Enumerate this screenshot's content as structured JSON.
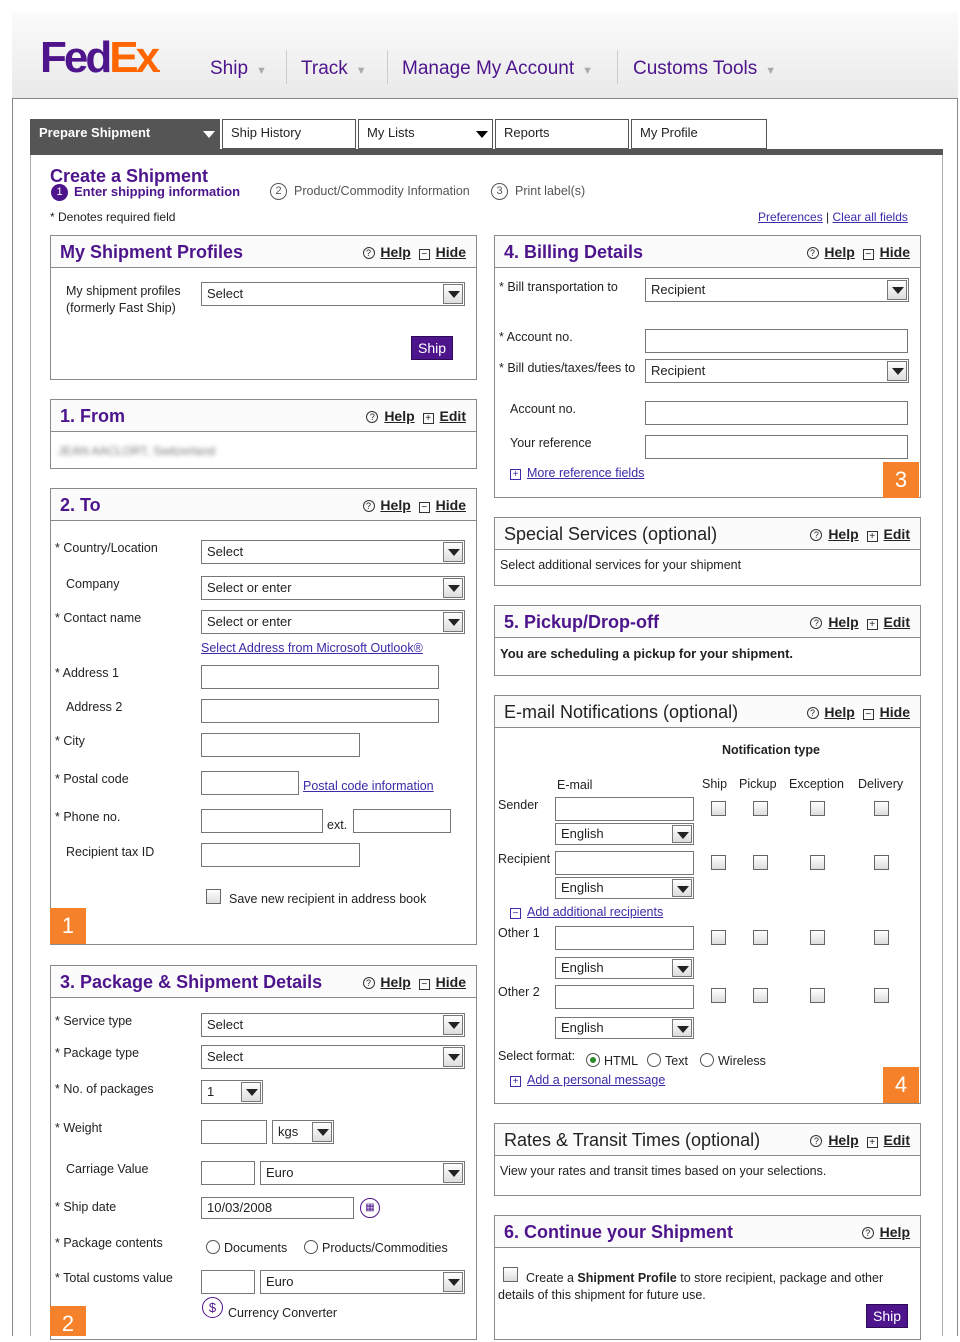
{
  "nav": {
    "logo_fed": "Fed",
    "logo_ex": "Ex",
    "items": [
      "Ship",
      "Track",
      "Manage My Account",
      "Customs Tools"
    ]
  },
  "tabs": [
    "Prepare Shipment",
    "Ship History",
    "My Lists",
    "Reports",
    "My Profile"
  ],
  "header": {
    "title": "Create a Shipment",
    "step1": "Enter shipping information",
    "step2": "Product/Commodity Information",
    "step3": "Print label(s)",
    "required_note": "* Denotes required field",
    "preferences": "Preferences",
    "clear": "Clear all fields",
    "sep": "|"
  },
  "common": {
    "help": "Help",
    "hide": "Hide",
    "edit": "Edit"
  },
  "profiles": {
    "title": "My Shipment Profiles",
    "label": "My shipment profiles (formerly Fast Ship)",
    "select": "Select",
    "ship": "Ship"
  },
  "from": {
    "title": "1. From",
    "value": "JEAN AACLORT, Switzerland"
  },
  "to": {
    "title": "2. To",
    "country": "* Country/Location",
    "country_val": "Select",
    "company": "Company",
    "company_val": "Select or enter",
    "contact": "* Contact name",
    "contact_val": "Select or enter",
    "outlook": "Select Address from Microsoft Outlook®",
    "addr1": "* Address 1",
    "addr2": "Address 2",
    "city": "* City",
    "postal": "* Postal code",
    "postal_info": "Postal code information",
    "phone": "* Phone no.",
    "ext": "ext.",
    "taxid": "Recipient tax ID",
    "save": "Save new recipient in address book"
  },
  "package": {
    "title": "3. Package & Shipment Details",
    "service": "* Service type",
    "service_val": "Select",
    "ptype": "* Package type",
    "ptype_val": "Select",
    "count": "* No. of packages",
    "count_val": "1",
    "weight": "* Weight",
    "weight_unit": "kgs",
    "carriage": "Carriage Value",
    "currency": "Euro",
    "shipdate": "* Ship date",
    "shipdate_val": "10/03/2008",
    "contents": "* Package contents",
    "documents": "Documents",
    "commodities": "Products/Commodities",
    "customs": "* Total customs value",
    "customs_currency": "Euro",
    "converter": "Currency Converter"
  },
  "billing": {
    "title": "4. Billing Details",
    "bill_transport": "* Bill transportation to",
    "bill_transport_val": "Recipient",
    "account1": "* Account no.",
    "bill_duties": "* Bill duties/taxes/fees to",
    "bill_duties_val": "Recipient",
    "account2": "Account no.",
    "reference": "Your reference",
    "more_ref": "More reference fields"
  },
  "special": {
    "title": "Special Services (optional)",
    "text": "Select additional services for your shipment"
  },
  "pickup": {
    "title": "5. Pickup/Drop-off",
    "text": "You are scheduling a pickup for your shipment."
  },
  "email": {
    "title": "E-mail Notifications (optional)",
    "notif_type": "Notification type",
    "col_email": "E-mail",
    "cols": [
      "Ship",
      "Pickup",
      "Exception",
      "Delivery"
    ],
    "rows": [
      "Sender",
      "Recipient",
      "Other 1",
      "Other 2"
    ],
    "lang": "English",
    "add_recipients": "Add additional recipients",
    "format_label": "Select format:",
    "formats": [
      "HTML",
      "Text",
      "Wireless"
    ],
    "add_message": "Add a personal message"
  },
  "rates": {
    "title": "Rates & Transit Times (optional)",
    "text": "View your rates and transit times based on your selections."
  },
  "continue": {
    "title": "6. Continue your Shipment",
    "pre": "Create a ",
    "bold": "Shipment Profile",
    "post": " to store recipient, package and other details of this shipment for future use.",
    "ship": "Ship"
  },
  "markers": [
    "1",
    "2",
    "3",
    "4"
  ]
}
